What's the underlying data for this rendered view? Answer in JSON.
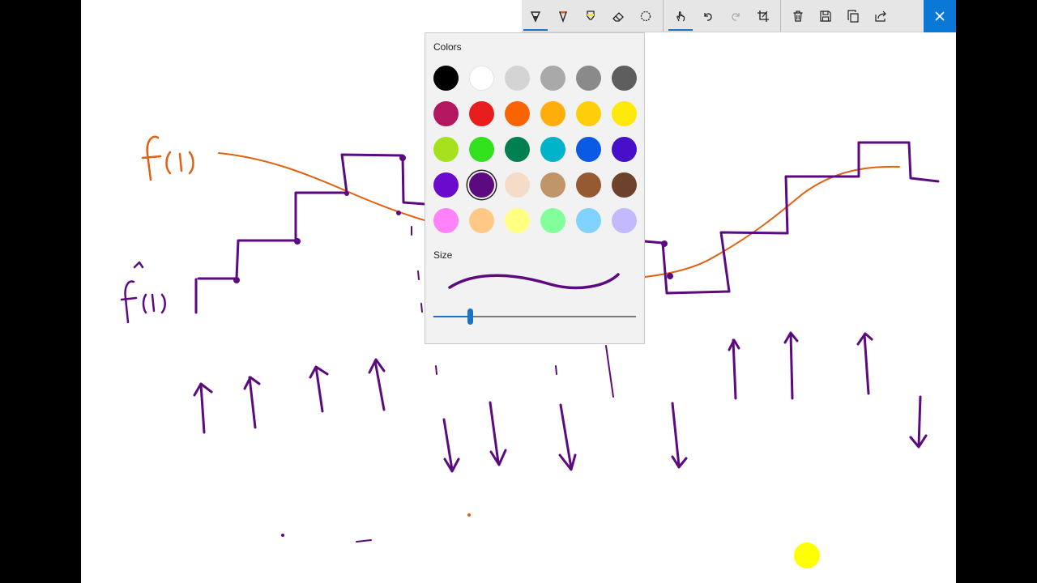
{
  "toolbar": {
    "tools": [
      {
        "id": "ballpoint-pen",
        "icon": "ballpoint-pen-icon",
        "active": true
      },
      {
        "id": "pencil",
        "icon": "pencil-icon",
        "active": false
      },
      {
        "id": "highlighter",
        "icon": "highlighter-icon",
        "active": false
      },
      {
        "id": "eraser",
        "icon": "eraser-icon",
        "active": false
      },
      {
        "id": "lasso",
        "icon": "lasso-icon",
        "active": false
      },
      {
        "id": "touch-writing",
        "icon": "touch-writing-icon",
        "active": true
      },
      {
        "id": "undo",
        "icon": "undo-icon",
        "active": false
      },
      {
        "id": "redo",
        "icon": "redo-icon",
        "active": false
      },
      {
        "id": "crop",
        "icon": "crop-icon",
        "active": false
      },
      {
        "id": "delete",
        "icon": "trash-icon",
        "active": false
      },
      {
        "id": "save",
        "icon": "save-icon",
        "active": false
      },
      {
        "id": "copy",
        "icon": "copy-icon",
        "active": false
      },
      {
        "id": "share",
        "icon": "share-icon",
        "active": false
      }
    ],
    "close_icon": "close-icon",
    "accent_color": "#0a78d7"
  },
  "color_panel": {
    "colors_label": "Colors",
    "size_label": "Size",
    "selected_color": "#5c0a80",
    "size_fraction": 0.18,
    "swatches": [
      "#000000",
      "#ffffff",
      "#d4d4d4",
      "#a9a9a9",
      "#8a8a8a",
      "#5e5e5e",
      "#b3175f",
      "#e81e1e",
      "#fa6400",
      "#ffad0a",
      "#ffce0a",
      "#ffe90a",
      "#a6e11e",
      "#32e11e",
      "#008050",
      "#00b3c8",
      "#0a5ae6",
      "#4610c8",
      "#6a0acd",
      "#5c0a80",
      "#f5dcc8",
      "#bf9569",
      "#965a32",
      "#6e412d",
      "#ff82fa",
      "#ffc887",
      "#ffff82",
      "#82ff9b",
      "#82d2ff",
      "#c3b9ff"
    ]
  }
}
